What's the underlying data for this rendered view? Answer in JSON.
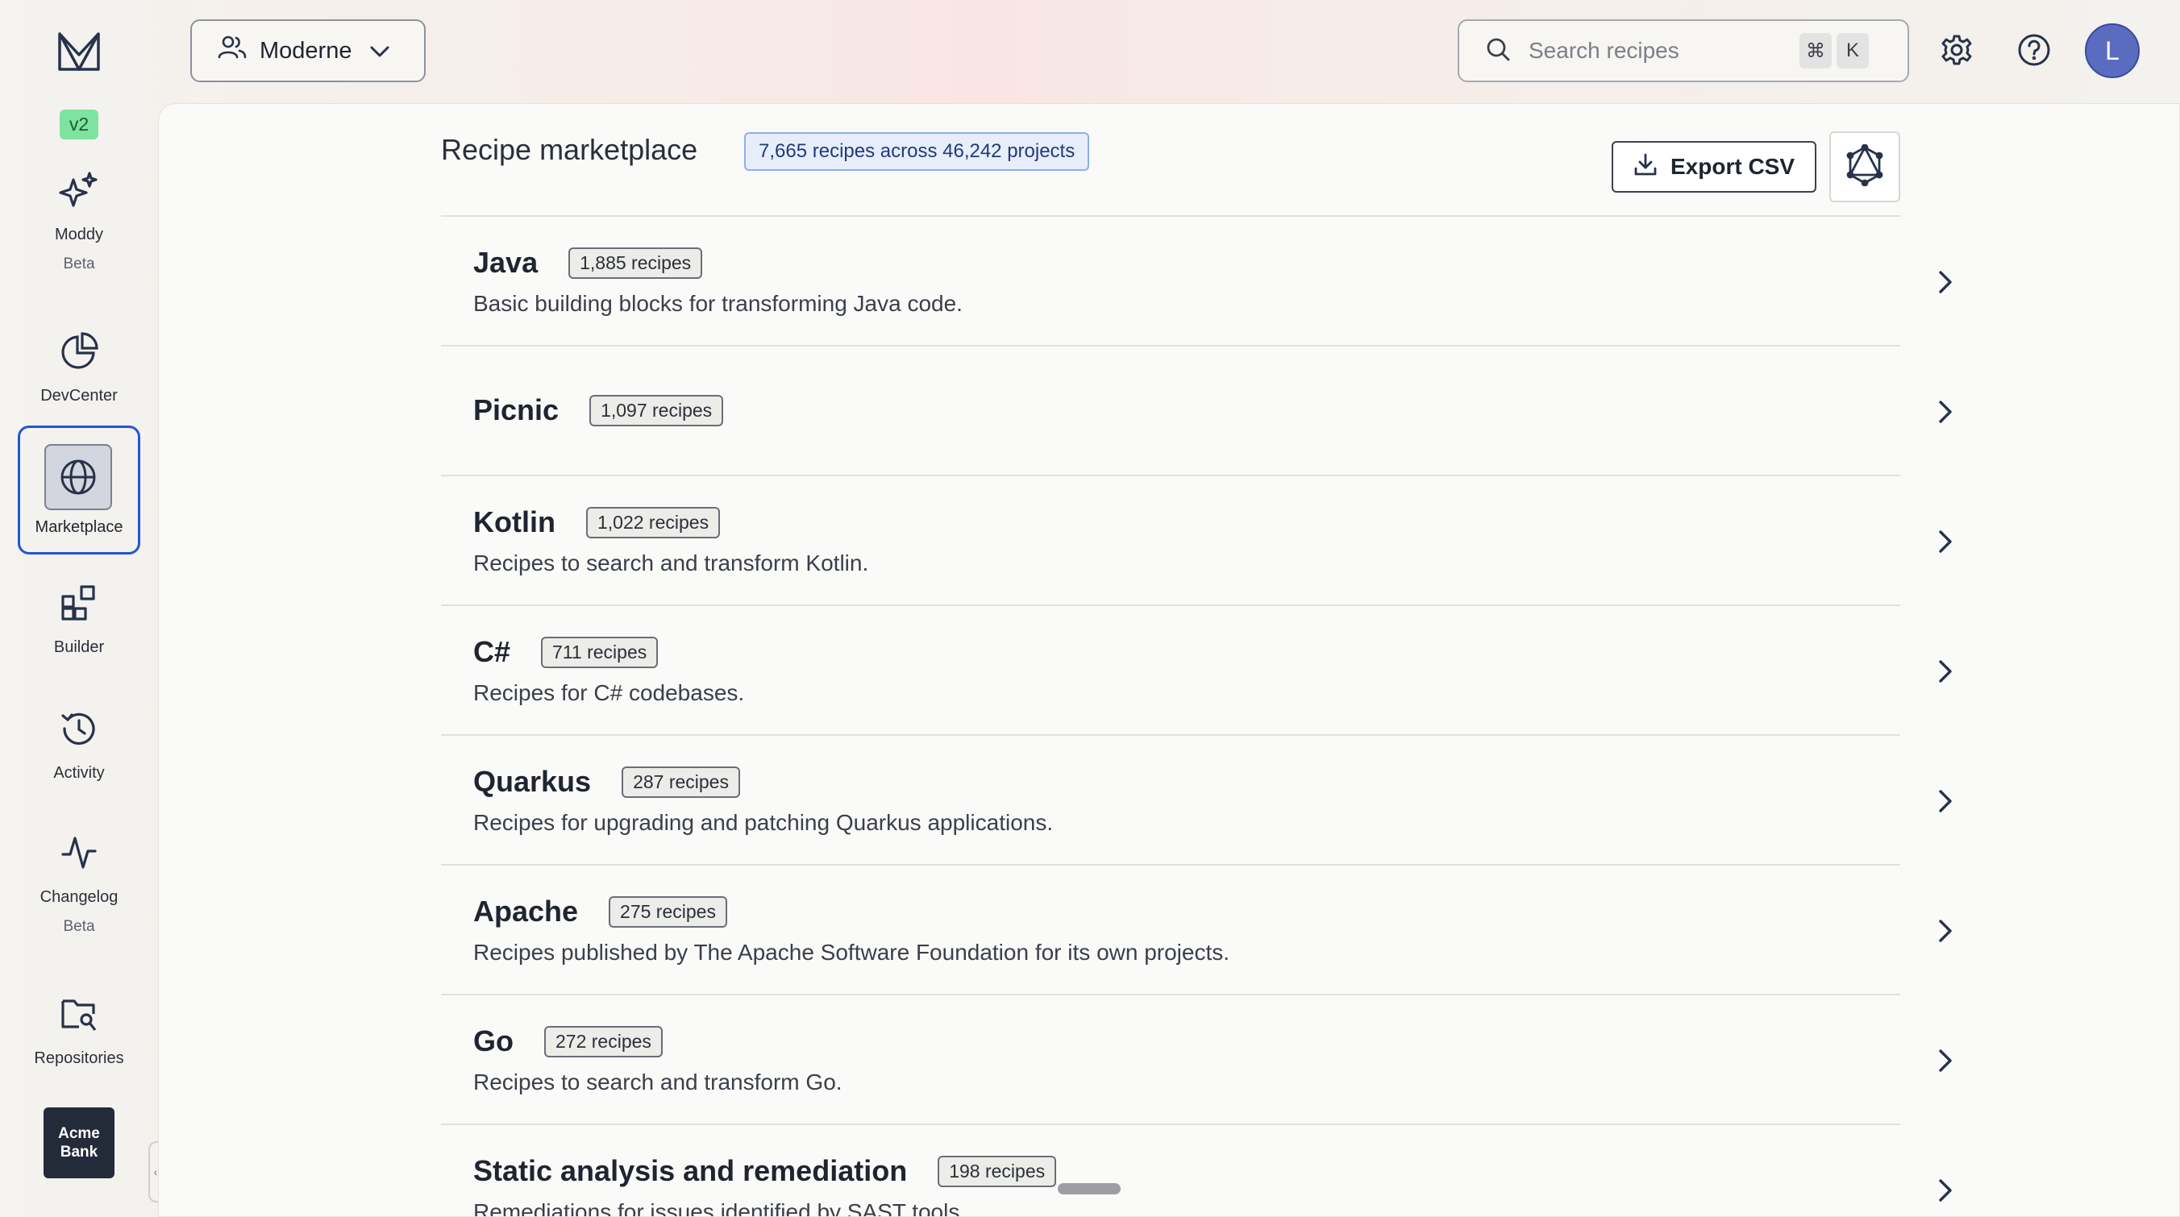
{
  "sidebar": {
    "version": "v2",
    "items": [
      {
        "label": "Moddy",
        "sub": "Beta"
      },
      {
        "label": "DevCenter"
      },
      {
        "label": "Marketplace"
      },
      {
        "label": "Builder"
      },
      {
        "label": "Activity"
      },
      {
        "label": "Changelog",
        "sub": "Beta"
      },
      {
        "label": "Repositories"
      }
    ],
    "org_tile": "Acme Bank"
  },
  "header": {
    "org_name": "Moderne",
    "search_placeholder": "Search recipes",
    "shortcut_mod": "⌘",
    "shortcut_key": "K",
    "avatar_initial": "L"
  },
  "main": {
    "title": "Recipe marketplace",
    "summary": "7,665 recipes across 46,242 projects",
    "export_label": "Export CSV",
    "categories": [
      {
        "name": "Java",
        "count": "1,885 recipes",
        "desc": "Basic building blocks for transforming Java code."
      },
      {
        "name": "Picnic",
        "count": "1,097 recipes",
        "desc": ""
      },
      {
        "name": "Kotlin",
        "count": "1,022 recipes",
        "desc": "Recipes to search and transform Kotlin."
      },
      {
        "name": "C#",
        "count": "711 recipes",
        "desc": "Recipes for C# codebases."
      },
      {
        "name": "Quarkus",
        "count": "287 recipes",
        "desc": "Recipes for upgrading and patching Quarkus applications."
      },
      {
        "name": "Apache",
        "count": "275 recipes",
        "desc": "Recipes published by The Apache Software Foundation for its own projects."
      },
      {
        "name": "Go",
        "count": "272 recipes",
        "desc": "Recipes to search and transform Go."
      },
      {
        "name": "Static analysis and remediation",
        "count": "198 recipes",
        "desc": "Remediations for issues identified by SAST tools."
      }
    ]
  },
  "colors": {
    "accent": "#2455d6",
    "version_badge": "#7ee3a0",
    "avatar": "#5a6cc0",
    "org_tile": "#232a3a"
  }
}
